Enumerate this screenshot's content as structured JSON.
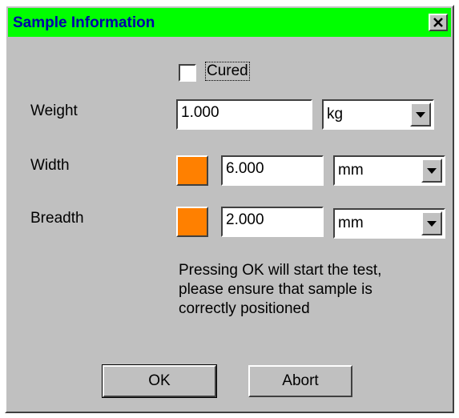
{
  "window": {
    "title": "Sample Information",
    "title_bar_color": "#00ff00",
    "title_text_color": "#0000a8",
    "close_icon": "close-icon"
  },
  "cured": {
    "label": "Cured",
    "checked": false
  },
  "weight": {
    "label": "Weight",
    "value": "1.000",
    "unit": "kg"
  },
  "width": {
    "label": "Width",
    "value": "6.000",
    "unit": "mm",
    "swatch_color": "#ff8000"
  },
  "breadth": {
    "label": "Breadth",
    "value": "2.000",
    "unit": "mm",
    "swatch_color": "#ff8000"
  },
  "message": {
    "line1": "Pressing OK will start the test,",
    "line2": "please ensure that sample is",
    "line3": "correctly positioned"
  },
  "buttons": {
    "ok": "OK",
    "abort": "Abort"
  }
}
